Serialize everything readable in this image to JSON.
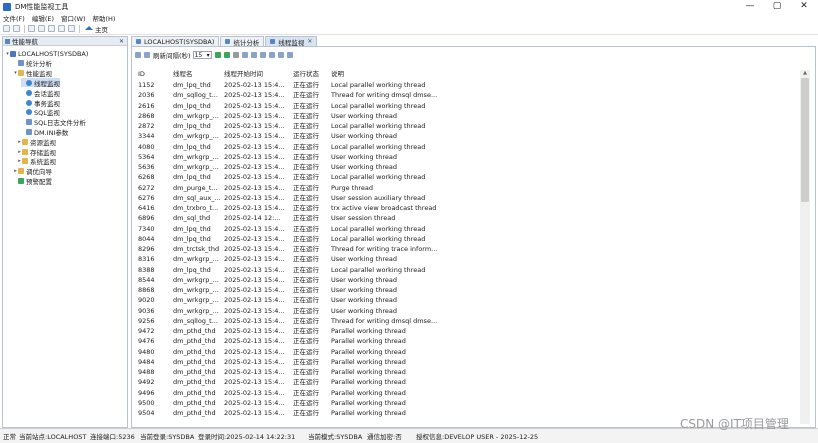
{
  "window": {
    "title": "DM性能监视工具",
    "controls": [
      "—",
      "▢",
      "✕"
    ]
  },
  "menu": [
    "文件(F)",
    "编辑(E)",
    "窗口(W)",
    "帮助(H)"
  ],
  "toolbar": {
    "home_label": "主页"
  },
  "navigator": {
    "title": "性能导航",
    "tree": [
      {
        "label": "LOCALHOST(SYSDBA)",
        "icon": "database-icon",
        "expander": "▾"
      },
      {
        "label": "统计分析",
        "icon": "chart-icon",
        "expander": ""
      },
      {
        "label": "性能监视",
        "icon": "folder-icon",
        "expander": "▾"
      },
      {
        "label": "线程监视",
        "icon": "thread-icon",
        "expander": ""
      },
      {
        "label": "会话监视",
        "icon": "session-icon",
        "expander": ""
      },
      {
        "label": "事务监视",
        "icon": "transaction-icon",
        "expander": ""
      },
      {
        "label": "SQL监视",
        "icon": "sql-icon",
        "expander": ""
      },
      {
        "label": "SQL日志文件分析",
        "icon": "sql-log-icon",
        "expander": ""
      },
      {
        "label": "DM.INI参数",
        "icon": "ini-icon",
        "expander": ""
      },
      {
        "label": "资源监视",
        "icon": "folder-icon",
        "expander": "▸"
      },
      {
        "label": "存储监视",
        "icon": "folder-icon",
        "expander": "▸"
      },
      {
        "label": "系统监视",
        "icon": "folder-icon",
        "expander": "▸"
      },
      {
        "label": "调优向导",
        "icon": "folder-icon",
        "expander": "▸"
      },
      {
        "label": "预警配置",
        "icon": "alert-icon",
        "expander": ""
      }
    ]
  },
  "tabs": [
    {
      "label": "LOCALHOST(SYSDBA)",
      "active": false
    },
    {
      "label": "统计分析",
      "active": false
    },
    {
      "label": "线程监视",
      "active": true,
      "close": "✕"
    }
  ],
  "content_toolbar": {
    "refresh_label": "刷新间隔(秒)",
    "refresh_value": "15"
  },
  "table": {
    "columns": [
      "ID",
      "线程名",
      "线程开始时间",
      "运行状态",
      "说明"
    ],
    "rows": [
      [
        "1152",
        "dm_lpq_thd",
        "2025-02-13 15:4...",
        "正在运行",
        "Local parallel working thread"
      ],
      [
        "2036",
        "dm_sqllog_t...",
        "2025-02-13 15:4...",
        "正在运行",
        "Thread for writing dmsql dmse..."
      ],
      [
        "2616",
        "dm_lpq_thd",
        "2025-02-13 15:4...",
        "正在运行",
        "Local parallel working thread"
      ],
      [
        "2868",
        "dm_wrkgrp_...",
        "2025-02-13 15:4...",
        "正在运行",
        "User working thread"
      ],
      [
        "2872",
        "dm_lpq_thd",
        "2025-02-13 15:4...",
        "正在运行",
        "Local parallel working thread"
      ],
      [
        "3344",
        "dm_wrkgrp_...",
        "2025-02-13 15:4...",
        "正在运行",
        "User working thread"
      ],
      [
        "4080",
        "dm_lpq_thd",
        "2025-02-13 15:4...",
        "正在运行",
        "Local parallel working thread"
      ],
      [
        "5364",
        "dm_wrkgrp_...",
        "2025-02-13 15:4...",
        "正在运行",
        "User working thread"
      ],
      [
        "5636",
        "dm_wrkgrp_...",
        "2025-02-13 15:4...",
        "正在运行",
        "User working thread"
      ],
      [
        "6268",
        "dm_lpq_thd",
        "2025-02-13 15:4...",
        "正在运行",
        "Local parallel working thread"
      ],
      [
        "6272",
        "dm_purge_t...",
        "2025-02-13 15:4...",
        "正在运行",
        "Purge thread"
      ],
      [
        "6276",
        "dm_sql_aux_...",
        "2025-02-13 15:4...",
        "正在运行",
        "User session auxiliary thread"
      ],
      [
        "6416",
        "dm_trxbro_t...",
        "2025-02-13 15:4...",
        "正在运行",
        "trx active view broadcast thread"
      ],
      [
        "6896",
        "dm_sql_thd",
        "2025-02-14 12:...",
        "正在运行",
        "User session thread"
      ],
      [
        "7340",
        "dm_lpq_thd",
        "2025-02-13 15:4...",
        "正在运行",
        "Local parallel working thread"
      ],
      [
        "8044",
        "dm_lpq_thd",
        "2025-02-13 15:4...",
        "正在运行",
        "Local parallel working thread"
      ],
      [
        "8296",
        "dm_trctsk_thd",
        "2025-02-13 15:4...",
        "正在运行",
        "Thread for writing trace inform..."
      ],
      [
        "8316",
        "dm_wrkgrp_...",
        "2025-02-13 15:4...",
        "正在运行",
        "User working thread"
      ],
      [
        "8388",
        "dm_lpq_thd",
        "2025-02-13 15:4...",
        "正在运行",
        "Local parallel working thread"
      ],
      [
        "8544",
        "dm_wrkgrp_...",
        "2025-02-13 15:4...",
        "正在运行",
        "User working thread"
      ],
      [
        "8868",
        "dm_wrkgrp_...",
        "2025-02-13 15:4...",
        "正在运行",
        "User working thread"
      ],
      [
        "9020",
        "dm_wrkgrp_...",
        "2025-02-13 15:4...",
        "正在运行",
        "User working thread"
      ],
      [
        "9036",
        "dm_wrkgrp_...",
        "2025-02-13 15:4...",
        "正在运行",
        "User working thread"
      ],
      [
        "9256",
        "dm_sqllog_t...",
        "2025-02-13 15:4...",
        "正在运行",
        "Thread for writing dmsql dmse..."
      ],
      [
        "9472",
        "dm_pthd_thd",
        "2025-02-13 15:4...",
        "正在运行",
        "Parallel working thread"
      ],
      [
        "9476",
        "dm_pthd_thd",
        "2025-02-13 15:4...",
        "正在运行",
        "Parallel working thread"
      ],
      [
        "9480",
        "dm_pthd_thd",
        "2025-02-13 15:4...",
        "正在运行",
        "Parallel working thread"
      ],
      [
        "9484",
        "dm_pthd_thd",
        "2025-02-13 15:4...",
        "正在运行",
        "Parallel working thread"
      ],
      [
        "9488",
        "dm_pthd_thd",
        "2025-02-13 15:4...",
        "正在运行",
        "Parallel working thread"
      ],
      [
        "9492",
        "dm_pthd_thd",
        "2025-02-13 15:4...",
        "正在运行",
        "Parallel working thread"
      ],
      [
        "9496",
        "dm_pthd_thd",
        "2025-02-13 15:4...",
        "正在运行",
        "Parallel working thread"
      ],
      [
        "9500",
        "dm_pthd_thd",
        "2025-02-13 15:4...",
        "正在运行",
        "Parallel working thread"
      ],
      [
        "9504",
        "dm_pthd_thd",
        "2025-02-13 15:4...",
        "正在运行",
        "Parallel working thread"
      ]
    ]
  },
  "statusbar": {
    "mode": "正常",
    "site": "当前站点:LOCALHOST",
    "port": "连接端口:5236",
    "login": "当前登录:SYSDBA",
    "login_time": "登录时间:2025-02-14 14:22:31",
    "run_mode": "当前模式:SYSDBA",
    "encrypt": "通信加密:否",
    "license": "授权信息:DEVELOP USER - 2025-12-25"
  },
  "watermark": "CSDN @IT项目管理",
  "colors": {
    "panel_border": "#b9c3cf",
    "header_bg": "#e6ecf3",
    "active_tab_bg": "#d8e4f2",
    "folder": "#e3b54a",
    "accent": "#3a6fbf"
  }
}
